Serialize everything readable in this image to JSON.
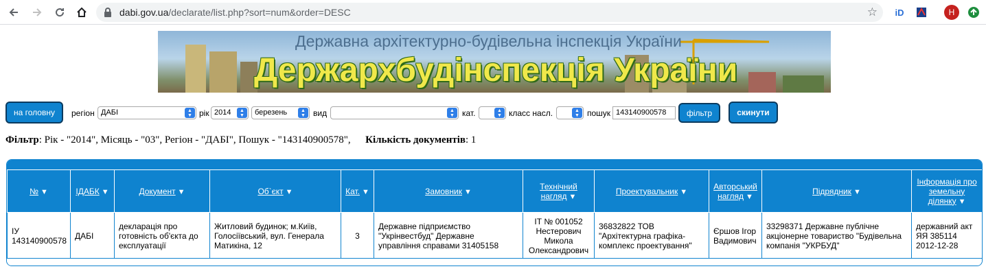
{
  "browser": {
    "url_host": "dabi.gov.ua",
    "url_path": "/declarate/list.php?sort=num&order=DESC",
    "profile_initial": "H"
  },
  "banner": {
    "subtitle": "Державна архітектурно-будівельна інспекція України",
    "title": "Держархбудінспекція України"
  },
  "filters": {
    "home_label": "на головну",
    "region_label": "регіон",
    "region_value": "ДАБІ",
    "year_label": "рік",
    "year_value": "2014",
    "month_value": "березень",
    "type_label": "вид",
    "type_value": "",
    "cat_label": "кат.",
    "cat_value": "",
    "class_label": "класс насл.",
    "class_value": "",
    "search_label": "пошук",
    "search_value": "143140900578",
    "filter_button": "фільтр",
    "reset_button": "скинути"
  },
  "summary": {
    "filter_bold": "Фільтр",
    "filter_text": ": Рік - \"2014\", Місяць - \"03\", Регіон - \"ДАБІ\", Пошук - \"143140900578\",",
    "count_bold": "Кількість документів",
    "count_text": ": 1"
  },
  "table": {
    "headers": [
      "№",
      "ІДАБК",
      "Документ",
      "Об`єкт",
      "Кат.",
      "Замовник",
      "Технічний нагляд",
      "Проектувальник",
      "Авторський нагляд",
      "Підрядник",
      "Інформація про земельну ділянку"
    ],
    "rows": [
      [
        "ІУ 143140900578",
        "ДАБІ",
        "декларація про готовність об'єкта до експлуатації",
        "Житловий будинок; м.Київ, Голосіївський, вул. Генерала Матикіна, 12",
        "3",
        "Державне підприємство \"Укрінвестбуд\" Державне управління справами 31405158",
        "ІТ № 001052 Нестерович Микола Олександрович",
        "36832822 ТОВ \"Архітектурна графіка-комплекс проектування\"",
        "Єршов Ігор Вадимович",
        "33298371 Державне публічне акціонерне товариство \"Будівельна компанія \"УКРБУД\"",
        "державний акт ЯЯ 385114 2012-12-28"
      ]
    ]
  },
  "colors": {
    "accent": "#0f83cf",
    "button_border": "#0b3a5e"
  }
}
